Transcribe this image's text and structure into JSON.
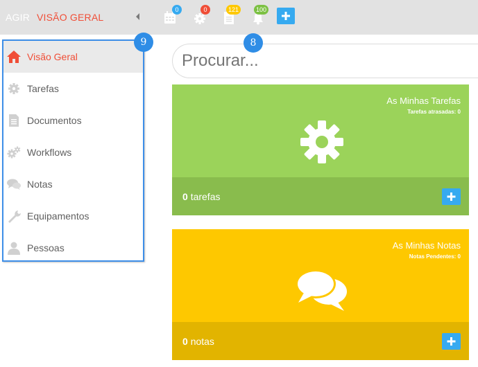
{
  "header": {
    "brand": "AGIR",
    "breadcrumb": "VISÃO GERAL",
    "badges": {
      "calendar": "0",
      "tasks": "0",
      "documents": "121",
      "notifications": "100"
    }
  },
  "sidebar": {
    "items": [
      {
        "label": "Visão Geral",
        "icon": "home-icon"
      },
      {
        "label": "Tarefas",
        "icon": "gear-icon"
      },
      {
        "label": "Documentos",
        "icon": "document-icon"
      },
      {
        "label": "Workflows",
        "icon": "gears-icon"
      },
      {
        "label": "Notas",
        "icon": "chat-icon"
      },
      {
        "label": "Equipamentos",
        "icon": "wrench-icon"
      },
      {
        "label": "Pessoas",
        "icon": "user-icon"
      }
    ]
  },
  "callouts": {
    "sidebar": "9",
    "search": "8"
  },
  "search": {
    "placeholder": "Procurar..."
  },
  "cards": {
    "tasks": {
      "title": "As Minhas Tarefas",
      "subtitle": "Tarefas atrasadas: 0",
      "count": "0",
      "unit": "tarefas"
    },
    "notes": {
      "title": "As Minhas Notas",
      "subtitle": "Notas Pendentes: 0",
      "count": "0",
      "unit": "notas"
    }
  },
  "colors": {
    "accent_red": "#f04e37",
    "accent_blue": "#36aaf0",
    "tasks_card": "#9bd35a",
    "tasks_card_footer": "#89bc4d",
    "notes_card": "#fec800",
    "notes_card_footer": "#e2b400",
    "badge_calendar": "#36aaf0",
    "badge_tasks": "#f04e37",
    "badge_documents": "#fec800",
    "badge_notifications": "#7cc143"
  }
}
